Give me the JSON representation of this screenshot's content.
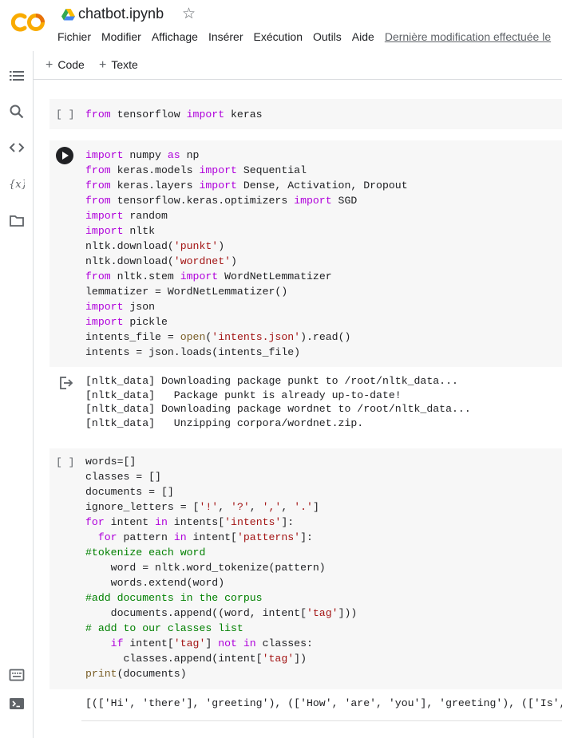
{
  "header": {
    "title": "chatbot.ipynb",
    "menu": [
      "Fichier",
      "Modifier",
      "Affichage",
      "Insérer",
      "Exécution",
      "Outils",
      "Aide"
    ],
    "last_modified": "Dernière modification effectuée le",
    "logo_text": "CO",
    "brand_colors": {
      "orange": "#F9AB00",
      "dark_orange": "#E8710A"
    }
  },
  "rail": {
    "icons": [
      "table-of-contents-icon",
      "search-icon",
      "code-snippets-icon",
      "variables-icon",
      "files-icon",
      "command-palette-icon",
      "terminal-icon"
    ]
  },
  "toolbar": {
    "add_code": "Code",
    "add_text": "Texte"
  },
  "cells": [
    {
      "bracket": "[ ]"
    },
    {
      "bracket": ""
    },
    {
      "bracket": "[ ]"
    }
  ],
  "outputs": [
    "[nltk_data] Downloading package punkt to /root/nltk_data...\n[nltk_data]   Package punkt is already up-to-date!\n[nltk_data] Downloading package wordnet to /root/nltk_data...\n[nltk_data]   Unzipping corpora/wordnet.zip.",
    "[(['Hi', 'there'], 'greeting'), (['How', 'are', 'you'], 'greeting'), (['Is', '"
  ],
  "colors": {
    "keyword": "#af00db",
    "string": "#a31515",
    "comment": "#008000",
    "cell_bg": "#f7f7f7"
  }
}
